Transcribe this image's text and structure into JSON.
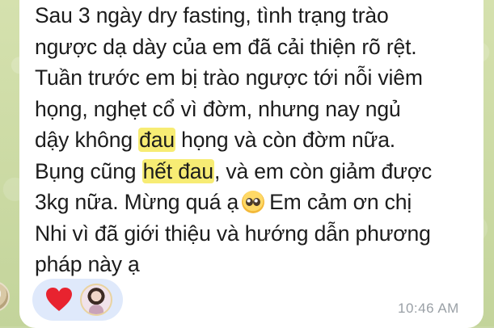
{
  "message": {
    "lines": [
      "Sau 3 ngày dry fasting, tình trạng trào",
      "ngược dạ dày của em đã cải thiện rõ rệt.",
      "Tuần trước em bị trào ngược tới nỗi viêm",
      "họng, nghẹt cổ vì đờm, nhưng nay ngủ"
    ],
    "line5_before": "dậy không ",
    "line5_highlight": "đau",
    "line5_after": " họng và còn đờm nữa.",
    "line6_before": "Bụng cũng ",
    "line6_highlight": "hết đau",
    "line6_after": ", và em còn giảm được",
    "line7_before": "3kg nữa. Mừng quá ạ",
    "line7_after": "Em cảm ơn chị",
    "line8": "Nhi vì đã giới thiệu và hướng dẫn phương",
    "line9": "pháp này ạ",
    "emoji_icon": "pleading-face-icon",
    "timestamp": "10:46 AM"
  },
  "reactions": {
    "items": [
      "heart-icon",
      "reactor-avatar"
    ]
  },
  "colors": {
    "highlight": "#f7ec74",
    "bubble": "#ffffff",
    "chat_background": "#c9d8a5",
    "reaction_pill": "#dfe9fb",
    "heart": "#e8232f",
    "timestamp": "#9aa0a6"
  }
}
